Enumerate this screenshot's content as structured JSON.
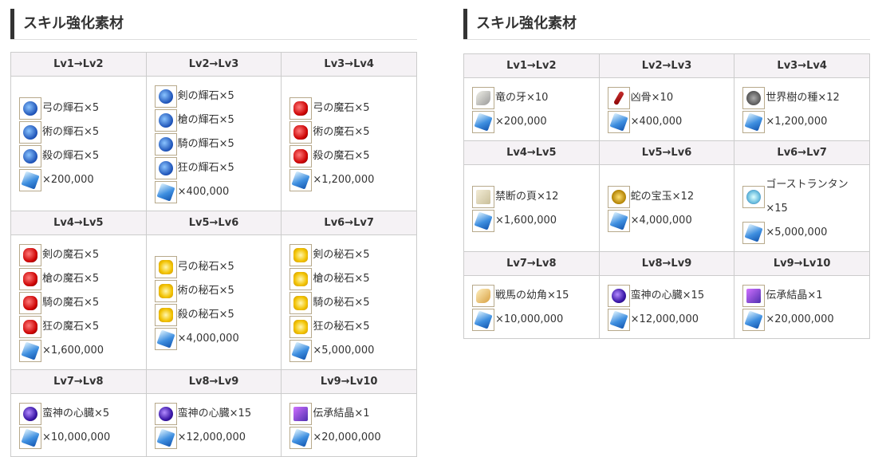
{
  "left": {
    "title": "スキル強化素材",
    "rows": [
      [
        {
          "level": "Lv1→Lv2",
          "items": [
            {
              "icon": "blue",
              "text": "弓の輝石×5"
            },
            {
              "icon": "blue",
              "text": "術の輝石×5"
            },
            {
              "icon": "blue",
              "text": "殺の輝石×5"
            },
            {
              "icon": "crystal",
              "text": "×200,000"
            }
          ]
        },
        {
          "level": "Lv2→Lv3",
          "items": [
            {
              "icon": "blue",
              "text": "剣の輝石×5"
            },
            {
              "icon": "blue",
              "text": "槍の輝石×5"
            },
            {
              "icon": "blue",
              "text": "騎の輝石×5"
            },
            {
              "icon": "blue",
              "text": "狂の輝石×5"
            },
            {
              "icon": "crystal",
              "text": "×400,000"
            }
          ]
        },
        {
          "level": "Lv3→Lv4",
          "items": [
            {
              "icon": "red",
              "text": "弓の魔石×5"
            },
            {
              "icon": "red",
              "text": "術の魔石×5"
            },
            {
              "icon": "red",
              "text": "殺の魔石×5"
            },
            {
              "icon": "crystal",
              "text": "×1,200,000"
            }
          ]
        }
      ],
      [
        {
          "level": "Lv4→Lv5",
          "items": [
            {
              "icon": "red",
              "text": "剣の魔石×5"
            },
            {
              "icon": "red",
              "text": "槍の魔石×5"
            },
            {
              "icon": "red",
              "text": "騎の魔石×5"
            },
            {
              "icon": "red",
              "text": "狂の魔石×5"
            },
            {
              "icon": "crystal",
              "text": "×1,600,000"
            }
          ]
        },
        {
          "level": "Lv5→Lv6",
          "items": [
            {
              "icon": "gold",
              "text": "弓の秘石×5"
            },
            {
              "icon": "gold",
              "text": "術の秘石×5"
            },
            {
              "icon": "gold",
              "text": "殺の秘石×5"
            },
            {
              "icon": "crystal",
              "text": "×4,000,000"
            }
          ]
        },
        {
          "level": "Lv6→Lv7",
          "items": [
            {
              "icon": "gold",
              "text": "剣の秘石×5"
            },
            {
              "icon": "gold",
              "text": "槍の秘石×5"
            },
            {
              "icon": "gold",
              "text": "騎の秘石×5"
            },
            {
              "icon": "gold",
              "text": "狂の秘石×5"
            },
            {
              "icon": "crystal",
              "text": "×5,000,000"
            }
          ]
        }
      ],
      [
        {
          "level": "Lv7→Lv8",
          "items": [
            {
              "icon": "heart",
              "text": "蛮神の心臓×5"
            },
            {
              "icon": "crystal",
              "text": "×10,000,000"
            }
          ]
        },
        {
          "level": "Lv8→Lv9",
          "items": [
            {
              "icon": "heart",
              "text": "蛮神の心臓×15"
            },
            {
              "icon": "crystal",
              "text": "×12,000,000"
            }
          ]
        },
        {
          "level": "Lv9→Lv10",
          "items": [
            {
              "icon": "book",
              "text": "伝承結晶×1"
            },
            {
              "icon": "crystal",
              "text": "×20,000,000"
            }
          ]
        }
      ]
    ]
  },
  "right": {
    "title": "スキル強化素材",
    "rows": [
      [
        {
          "level": "Lv1→Lv2",
          "items": [
            {
              "icon": "fang",
              "text": "竜の牙×10"
            },
            {
              "icon": "crystal",
              "text": "×200,000"
            }
          ]
        },
        {
          "level": "Lv2→Lv3",
          "items": [
            {
              "icon": "bone",
              "text": "凶骨×10"
            },
            {
              "icon": "crystal",
              "text": "×400,000"
            }
          ]
        },
        {
          "level": "Lv3→Lv4",
          "items": [
            {
              "icon": "seed",
              "text": "世界樹の種×12"
            },
            {
              "icon": "crystal",
              "text": "×1,200,000"
            }
          ]
        }
      ],
      [
        {
          "level": "Lv4→Lv5",
          "items": [
            {
              "icon": "paper",
              "text": "禁断の頁×12"
            },
            {
              "icon": "crystal",
              "text": "×1,600,000"
            }
          ]
        },
        {
          "level": "Lv5→Lv6",
          "items": [
            {
              "icon": "orb",
              "text": "蛇の宝玉×12"
            },
            {
              "icon": "crystal",
              "text": "×4,000,000"
            }
          ]
        },
        {
          "level": "Lv6→Lv7",
          "items": [
            {
              "icon": "lamp",
              "text": "ゴーストランタン×15"
            },
            {
              "icon": "crystal",
              "text": "×5,000,000"
            }
          ]
        }
      ],
      [
        {
          "level": "Lv7→Lv8",
          "items": [
            {
              "icon": "horn",
              "text": "戦馬の幼角×15"
            },
            {
              "icon": "crystal",
              "text": "×10,000,000"
            }
          ]
        },
        {
          "level": "Lv8→Lv9",
          "items": [
            {
              "icon": "heart",
              "text": "蛮神の心臓×15"
            },
            {
              "icon": "crystal",
              "text": "×12,000,000"
            }
          ]
        },
        {
          "level": "Lv9→Lv10",
          "items": [
            {
              "icon": "book",
              "text": "伝承結晶×1"
            },
            {
              "icon": "crystal",
              "text": "×20,000,000"
            }
          ]
        }
      ]
    ]
  }
}
